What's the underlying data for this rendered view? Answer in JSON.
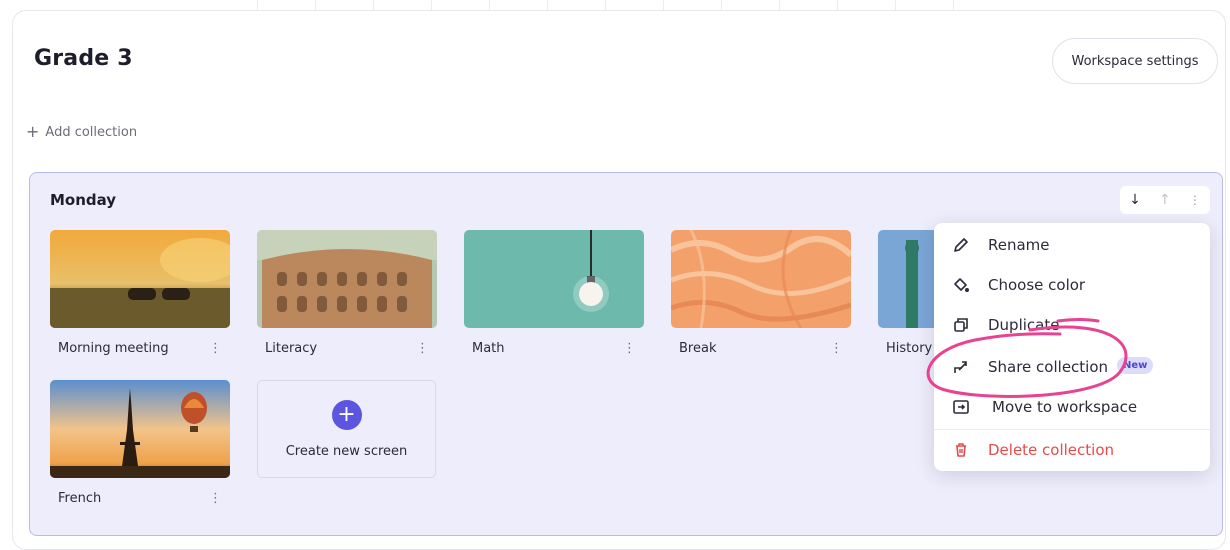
{
  "workspace": {
    "title": "Grade 3",
    "settings_label": "Workspace settings",
    "add_collection_label": "Add collection"
  },
  "collection": {
    "name": "Monday",
    "border_color": "#b9b9f0",
    "background_color": "#ededfb",
    "screens": [
      {
        "label": "Morning meeting"
      },
      {
        "label": "Literacy"
      },
      {
        "label": "Math"
      },
      {
        "label": "Break"
      },
      {
        "label": "History"
      },
      {
        "label": "French"
      }
    ],
    "create_label": "Create new screen"
  },
  "menu": {
    "items": [
      {
        "label": "Rename",
        "icon": "pencil-icon"
      },
      {
        "label": "Choose color",
        "icon": "paint-bucket-icon"
      },
      {
        "label": "Duplicate",
        "icon": "duplicate-icon"
      },
      {
        "label": "Share collection",
        "icon": "share-icon",
        "badge": "New"
      },
      {
        "label": "Move to workspace",
        "icon": "move-to-folder-icon"
      },
      {
        "label": "Delete collection",
        "icon": "trash-icon"
      }
    ]
  },
  "colors": {
    "accent": "#5b55e0",
    "danger": "#e84a4a",
    "annotation": "#e84393"
  }
}
